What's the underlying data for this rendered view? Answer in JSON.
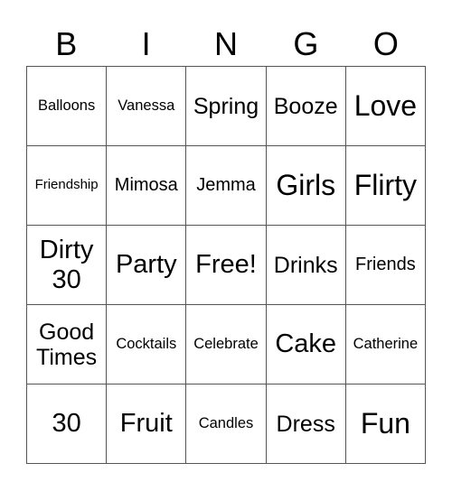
{
  "card": {
    "header": [
      "B",
      "I",
      "N",
      "G",
      "O"
    ],
    "rows": [
      [
        {
          "text": "Balloons",
          "size": "s-s"
        },
        {
          "text": "Vanessa",
          "size": "s-s"
        },
        {
          "text": "Spring",
          "size": "s-l"
        },
        {
          "text": "Booze",
          "size": "s-l"
        },
        {
          "text": "Love",
          "size": "s-xxl"
        }
      ],
      [
        {
          "text": "Friendship",
          "size": "s-xs"
        },
        {
          "text": "Mimosa",
          "size": "s-m"
        },
        {
          "text": "Jemma",
          "size": "s-m"
        },
        {
          "text": "Girls",
          "size": "s-xxl"
        },
        {
          "text": "Flirty",
          "size": "s-xxl"
        }
      ],
      [
        {
          "text": "Dirty\n30",
          "size": "s-xl"
        },
        {
          "text": "Party",
          "size": "s-xl"
        },
        {
          "text": "Free!",
          "size": "s-xl"
        },
        {
          "text": "Drinks",
          "size": "s-l"
        },
        {
          "text": "Friends",
          "size": "s-m"
        }
      ],
      [
        {
          "text": "Good\nTimes",
          "size": "s-l"
        },
        {
          "text": "Cocktails",
          "size": "s-s"
        },
        {
          "text": "Celebrate",
          "size": "s-s"
        },
        {
          "text": "Cake",
          "size": "s-xl"
        },
        {
          "text": "Catherine",
          "size": "s-s"
        }
      ],
      [
        {
          "text": "30",
          "size": "s-xl"
        },
        {
          "text": "Fruit",
          "size": "s-xl"
        },
        {
          "text": "Candles",
          "size": "s-s"
        },
        {
          "text": "Dress",
          "size": "s-l"
        },
        {
          "text": "Fun",
          "size": "s-xxl"
        }
      ]
    ]
  }
}
